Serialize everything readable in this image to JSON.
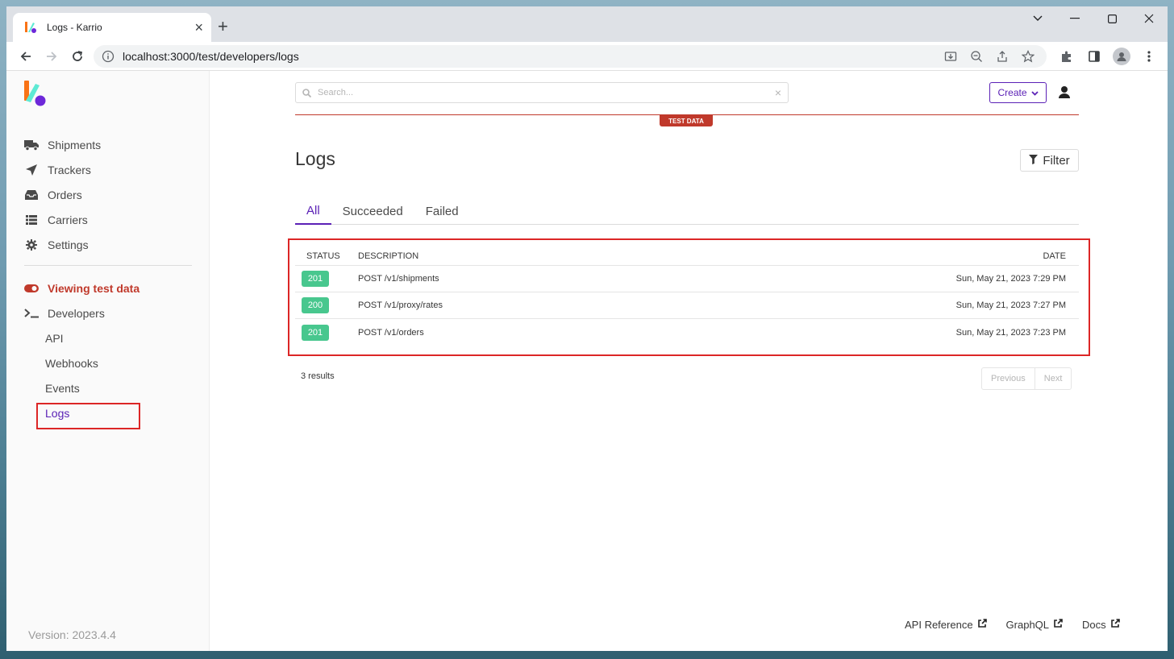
{
  "browser": {
    "tab_title": "Logs - Karrio",
    "new_tab": "+",
    "url": "localhost:3000/test/developers/logs"
  },
  "search": {
    "placeholder": "Search..."
  },
  "header": {
    "create_label": "Create",
    "test_badge": "TEST DATA"
  },
  "sidebar": {
    "items": [
      {
        "label": "Shipments",
        "icon": "truck-icon"
      },
      {
        "label": "Trackers",
        "icon": "paper-plane-icon"
      },
      {
        "label": "Orders",
        "icon": "inbox-icon"
      },
      {
        "label": "Carriers",
        "icon": "list-icon"
      },
      {
        "label": "Settings",
        "icon": "gear-icon"
      }
    ],
    "test_toggle": "Viewing test data",
    "developers": "Developers",
    "sub_items": [
      "API",
      "Webhooks",
      "Events",
      "Logs"
    ],
    "version": "Version: 2023.4.4"
  },
  "page": {
    "title": "Logs",
    "filter_label": "Filter",
    "tabs": [
      "All",
      "Succeeded",
      "Failed"
    ]
  },
  "table": {
    "headers": {
      "status": "STATUS",
      "description": "DESCRIPTION",
      "date": "DATE"
    },
    "rows": [
      {
        "status": "201",
        "description": "POST /v1/shipments",
        "date": "Sun, May 21, 2023 7:29 PM"
      },
      {
        "status": "200",
        "description": "POST /v1/proxy/rates",
        "date": "Sun, May 21, 2023 7:27 PM"
      },
      {
        "status": "201",
        "description": "POST /v1/orders",
        "date": "Sun, May 21, 2023 7:23 PM"
      }
    ]
  },
  "pagination": {
    "results": "3 results",
    "previous": "Previous",
    "next": "Next"
  },
  "footer": {
    "api_reference": "API Reference",
    "graphql": "GraphQL",
    "docs": "Docs"
  },
  "colors": {
    "accent": "#5b21b6",
    "test": "#c0392b",
    "success": "#48c78e",
    "highlight": "#dc2626"
  }
}
